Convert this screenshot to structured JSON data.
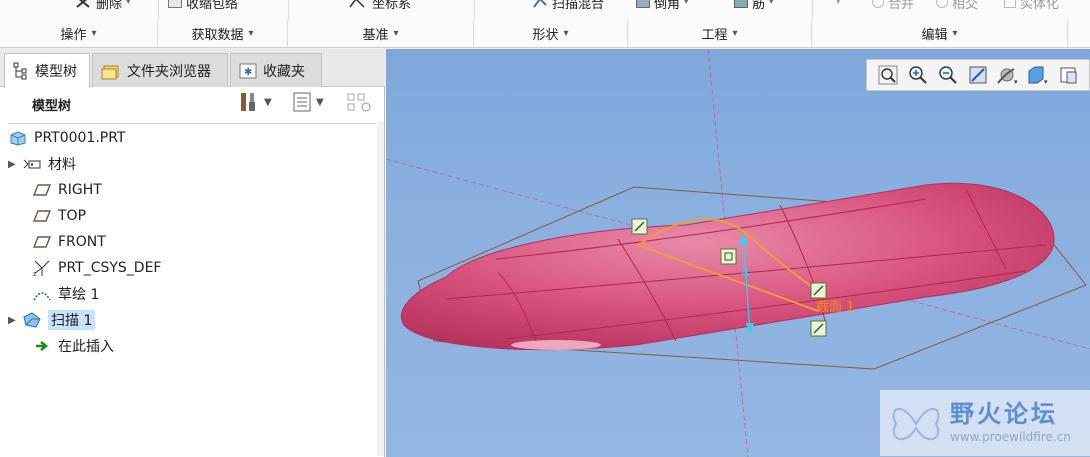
{
  "ribbon": {
    "top_buttons": [
      {
        "label": "删除",
        "icon": "delete-icon"
      },
      {
        "label": "收缩包络",
        "icon": "shrinkwrap-icon"
      },
      {
        "label": "坐标系",
        "icon": "csys-icon"
      },
      {
        "label": "扫描混合",
        "icon": "swept-blend-icon"
      },
      {
        "label": "倒角",
        "icon": "chamfer-icon"
      },
      {
        "label": "筋",
        "icon": "rib-icon"
      },
      {
        "label": "合并",
        "icon": "merge-icon"
      },
      {
        "label": "相交",
        "icon": "intersect-icon"
      },
      {
        "label": "实体化",
        "icon": "solidify-icon"
      }
    ],
    "groups": [
      "操作",
      "获取数据",
      "基准",
      "形状",
      "工程",
      "编辑"
    ]
  },
  "tabs": [
    {
      "label": "模型树",
      "icon": "model-tree-icon"
    },
    {
      "label": "文件夹浏览器",
      "icon": "folder-icon"
    },
    {
      "label": "收藏夹",
      "icon": "favorites-icon"
    }
  ],
  "tree": {
    "title": "模型树",
    "nodes": [
      {
        "label": "PRT0001.PRT",
        "icon": "part-icon",
        "expandable": false
      },
      {
        "label": "材料",
        "icon": "material-icon",
        "expandable": true
      },
      {
        "label": "RIGHT",
        "icon": "datum-plane-icon",
        "expandable": false
      },
      {
        "label": "TOP",
        "icon": "datum-plane-icon",
        "expandable": false
      },
      {
        "label": "FRONT",
        "icon": "datum-plane-icon",
        "expandable": false
      },
      {
        "label": "PRT_CSYS_DEF",
        "icon": "csys-icon",
        "expandable": false
      },
      {
        "label": "草绘 1",
        "icon": "sketch-icon",
        "expandable": false
      },
      {
        "label": "扫描 1",
        "icon": "sweep-icon",
        "expandable": true,
        "selected": true
      },
      {
        "label": "在此插入",
        "icon": "insert-here-icon",
        "expandable": false
      }
    ]
  },
  "viewport": {
    "dimension_label": "4",
    "section_label": "截面 1",
    "shape_color": "#d9557f",
    "background": "#8ab0e0"
  },
  "watermark": {
    "title": "野火论坛",
    "url": "www.proewildfire.cn"
  }
}
